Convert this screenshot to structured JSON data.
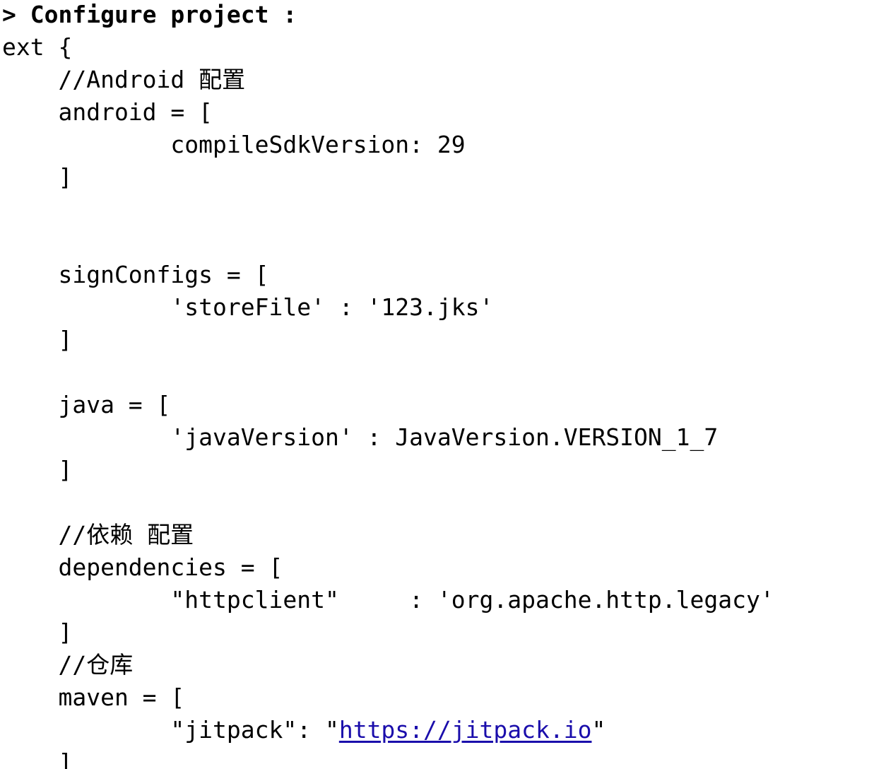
{
  "console": {
    "header": "> Configure project :",
    "lines": {
      "l01": "ext {",
      "l02": "    //Android 配置",
      "l03": "    android = [",
      "l04": "            compileSdkVersion: 29",
      "l05": "    ]",
      "l06": "    signConfigs = [",
      "l07": "            'storeFile' : '123.jks'",
      "l08": "    ]",
      "l09": "    java = [",
      "l10": "            'javaVersion' : JavaVersion.VERSION_1_7",
      "l11": "    ]",
      "l12": "    //依赖 配置",
      "l13": "    dependencies = [",
      "l14": "            \"httpclient\"     : 'org.apache.http.legacy'",
      "l15": "    ]",
      "l16": "    //仓库",
      "l17": "    maven = [",
      "l18_prefix": "            \"jitpack\": \"",
      "l18_link": "https://jitpack.io",
      "l18_suffix": "\"",
      "l19": "    ]"
    },
    "colors": {
      "text": "#000000",
      "link": "#1a0dab",
      "background": "#ffffff"
    }
  }
}
